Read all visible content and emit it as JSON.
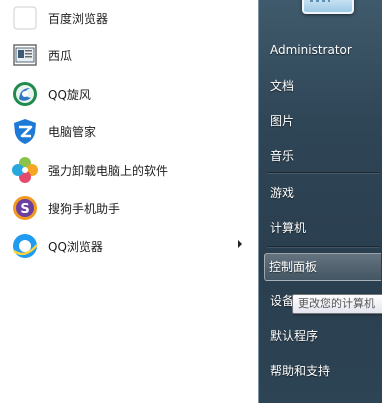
{
  "programs": [
    {
      "label": "百度浏览器",
      "icon": "baidu-browser-icon"
    },
    {
      "label": "西瓜",
      "icon": "xigua-icon"
    },
    {
      "label": "QQ旋风",
      "icon": "qq-xuanfeng-icon"
    },
    {
      "label": "电脑管家",
      "icon": "pc-manager-shield-icon"
    },
    {
      "label": "强力卸载电脑上的软件",
      "icon": "uninstaller-pinwheel-icon"
    },
    {
      "label": "搜狗手机助手",
      "icon": "sogou-phone-assistant-icon"
    },
    {
      "label": "QQ浏览器",
      "icon": "qq-browser-icon",
      "has_submenu": true
    }
  ],
  "right_panel": {
    "user_name": "Administrator",
    "items": [
      "文档",
      "图片",
      "音乐",
      "游戏",
      "计算机",
      "控制面板",
      "设备",
      "默认程序",
      "帮助和支持"
    ],
    "highlighted": "控制面板"
  },
  "tooltip": {
    "text": "更改您的计算机"
  },
  "colors": {
    "right_panel_bg": "#2f4657",
    "highlight": "#ffffff"
  }
}
